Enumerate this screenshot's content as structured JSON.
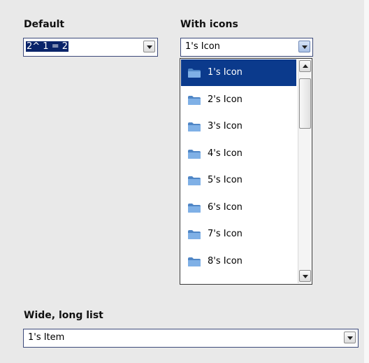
{
  "default_combo": {
    "label": "Default",
    "value": "2^ 1 = 2"
  },
  "icons_combo": {
    "label": "With icons",
    "value": "1's Icon",
    "list_items": [
      {
        "label": "1's Icon",
        "icon": "folder-icon",
        "selected": true
      },
      {
        "label": "2's Icon",
        "icon": "folder-icon"
      },
      {
        "label": "3's Icon",
        "icon": "folder-icon"
      },
      {
        "label": "4's Icon",
        "icon": "folder-icon"
      },
      {
        "label": "5's Icon",
        "icon": "folder-icon"
      },
      {
        "label": "6's Icon",
        "icon": "folder-icon"
      },
      {
        "label": "7's Icon",
        "icon": "folder-icon"
      },
      {
        "label": "8's Icon",
        "icon": "folder-icon"
      }
    ]
  },
  "wide_combo": {
    "label": "Wide, long list",
    "value": "1's Item"
  },
  "colors": {
    "selection": "#0b3a8c",
    "background": "#ebebeb",
    "border": "#3c4a7a"
  }
}
